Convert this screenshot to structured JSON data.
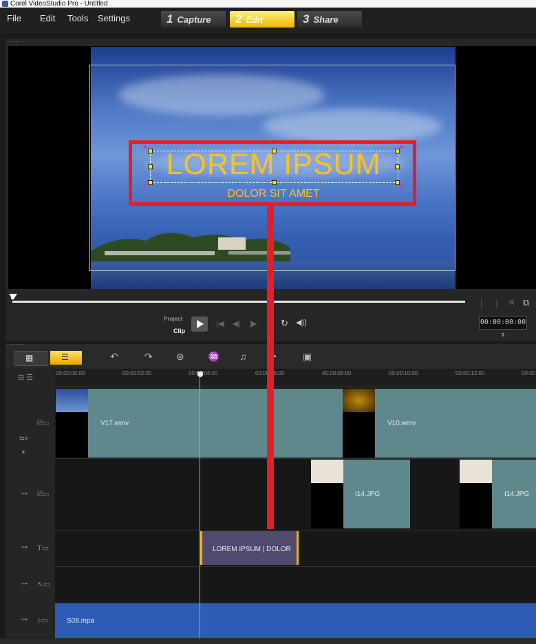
{
  "app": {
    "title": "Corel VideoStudio Pro - Untitled"
  },
  "menu": [
    "File",
    "Edit",
    "Tools",
    "Settings"
  ],
  "steps": [
    {
      "num": "1",
      "label": "Capture"
    },
    {
      "num": "2",
      "label": "Edit"
    },
    {
      "num": "3",
      "label": "Share"
    }
  ],
  "preview": {
    "title_text": "LOREM IPSUM",
    "subtitle_text": "DOLOR SIT AMET",
    "dots": "........"
  },
  "player": {
    "project_label": "Project",
    "clip_label": "Clip",
    "timecode": "00:00:00:00",
    "bracket_start": "[",
    "bracket_end": "]"
  },
  "ruler": {
    "ticks": [
      "00:00:00:00",
      "00:00:02:00",
      "00:00:04:00",
      "00:00:06:00",
      "00:00:08:00",
      "00:00:10:00",
      "00:00:12:00",
      "00:00"
    ]
  },
  "tracks": {
    "video": {
      "clips": [
        "V17.wmv",
        "V10.wmv"
      ]
    },
    "overlay": {
      "clips": [
        "I14.JPG",
        "I14.JPG"
      ]
    },
    "title": {
      "clips": [
        "LOREM IPSUM | DOLOR"
      ]
    },
    "music": {
      "clips": [
        "S08.mpa"
      ]
    }
  },
  "colors": {
    "accent": "#f0b500",
    "highlight": "#e41e26",
    "title_text": "#ffc21a",
    "audio_track": "#2d5bb5",
    "video_clip": "#5f888d"
  }
}
